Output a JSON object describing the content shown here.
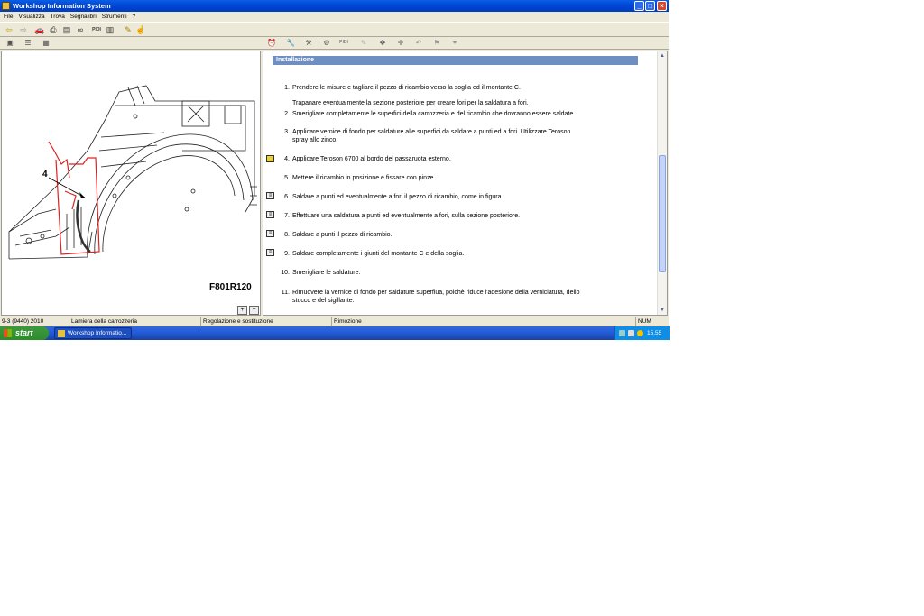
{
  "window": {
    "title": "Workshop Information System"
  },
  "menu": [
    "File",
    "Visualizza",
    "Trova",
    "Segnalibri",
    "Strumenti",
    "?"
  ],
  "toolbar_icons": [
    "back-icon",
    "forward-icon",
    "car-icon",
    "print-icon",
    "bookmark-icon",
    "binoculars-icon",
    "pidi-icon",
    "trash-icon",
    "pencil-icon",
    "pointer-icon"
  ],
  "toolbar2_right_icons": [
    "clock-icon",
    "wrench-icon",
    "tools-icon",
    "gear-icon",
    "pidi-icon",
    "pen-icon",
    "move-icon",
    "crosshair-icon",
    "undo-icon",
    "flag-icon",
    "funnel-icon"
  ],
  "figure": {
    "callout": "4",
    "label": "F801R120"
  },
  "section": {
    "title": "Installazione"
  },
  "steps": [
    {
      "num": "1.",
      "text": "Prendere le misure e tagliare il pezzo di ricambio verso la soglia ed il montante C."
    },
    {
      "num": "",
      "text": "Trapanare eventualmente la sezione posteriore per creare fori per la saldatura a fori."
    },
    {
      "num": "2.",
      "text": "Smerigliare completamente le superfici della carrozzeria e del ricambio che dovranno essere saldate."
    },
    {
      "num": "3.",
      "text": "Applicare vernice di fondo per saldature alle superfici da saldare a punti ed a fori. Utilizzare Teroson",
      "text2": "spray allo zinco."
    },
    {
      "num": "4.",
      "text": "Applicare Teroson 6700 al bordo del passaruota esterno."
    },
    {
      "num": "5.",
      "text": "Mettere il ricambio in posizione e fissare con pinze."
    },
    {
      "num": "6.",
      "text": "Saldare a punti ed eventualmente a fori il pezzo di ricambio, come in figura."
    },
    {
      "num": "7.",
      "text": "Effettuare una saldatura a punti ed eventualmente a fori, sulla sezione posteriore."
    },
    {
      "num": "8.",
      "text": "Saldare a punti il pezzo di ricambio."
    },
    {
      "num": "9.",
      "text": "Saldare completamente i giunti del montante C e della soglia."
    },
    {
      "num": "10.",
      "text": "Smerigliare le saldature."
    },
    {
      "num": "11.",
      "text": "Rimuovere la vernice di fondo per saldature superflua, poichè riduce l'adesione della verniciatura, dello",
      "text2": "stucco e del sigillante."
    }
  ],
  "status": {
    "model": "9-3 (9440) 2010",
    "group": "Lamiera della carrozzeria",
    "operation": "Regolazione e sostituzione",
    "task": "Rimozione",
    "num": "NUM"
  },
  "taskbar": {
    "start": "start",
    "item": "Workshop Informatio...",
    "clock": "15.55"
  },
  "colors": {
    "titlebar": "#0046d5",
    "section_header": "#6f8fc3",
    "annotation_red": "#e02020"
  }
}
